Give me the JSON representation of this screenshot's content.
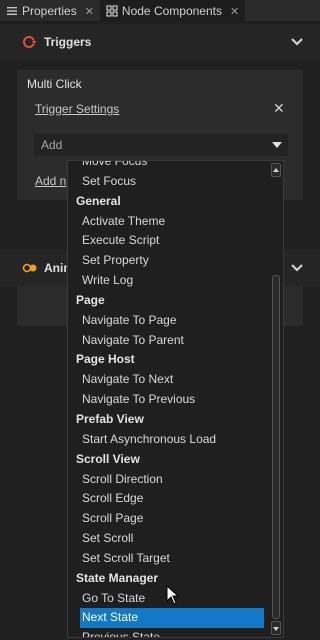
{
  "tabs": [
    {
      "label": "Properties",
      "icon": "wrench-icon"
    },
    {
      "label": "Node Components",
      "icon": "components-icon"
    }
  ],
  "triggers_section": {
    "title": "Triggers",
    "icon": "trigger-icon"
  },
  "trigger_card": {
    "title": "Multi Click",
    "settings_link": "Trigger Settings",
    "remove_label": "✕",
    "add_select": "Add",
    "add_link": "Add n"
  },
  "animations_section": {
    "title": "Anim",
    "icon": "animation-icon"
  },
  "dropdown": {
    "rows": [
      {
        "type": "item",
        "label": "Move Focus"
      },
      {
        "type": "item",
        "label": "Set Focus"
      },
      {
        "type": "group",
        "label": "General"
      },
      {
        "type": "item",
        "label": "Activate Theme"
      },
      {
        "type": "item",
        "label": "Execute Script"
      },
      {
        "type": "item",
        "label": "Set Property"
      },
      {
        "type": "item",
        "label": "Write Log"
      },
      {
        "type": "group",
        "label": "Page"
      },
      {
        "type": "item",
        "label": "Navigate To Page"
      },
      {
        "type": "item",
        "label": "Navigate To Parent"
      },
      {
        "type": "group",
        "label": "Page Host"
      },
      {
        "type": "item",
        "label": "Navigate To Next"
      },
      {
        "type": "item",
        "label": "Navigate To Previous"
      },
      {
        "type": "group",
        "label": "Prefab View"
      },
      {
        "type": "item",
        "label": "Start Asynchronous Load"
      },
      {
        "type": "group",
        "label": "Scroll View"
      },
      {
        "type": "item",
        "label": "Scroll Direction"
      },
      {
        "type": "item",
        "label": "Scroll Edge"
      },
      {
        "type": "item",
        "label": "Scroll Page"
      },
      {
        "type": "item",
        "label": "Set Scroll"
      },
      {
        "type": "item",
        "label": "Set Scroll Target"
      },
      {
        "type": "group",
        "label": "State Manager"
      },
      {
        "type": "item",
        "label": "Go To State"
      },
      {
        "type": "item",
        "label": "Next State",
        "selected": true
      },
      {
        "type": "item",
        "label": "Previous State"
      }
    ]
  },
  "colors": {
    "selection": "#1279c7",
    "trigger_icon": "#e0503c",
    "animation_icon": "#f0a020"
  }
}
